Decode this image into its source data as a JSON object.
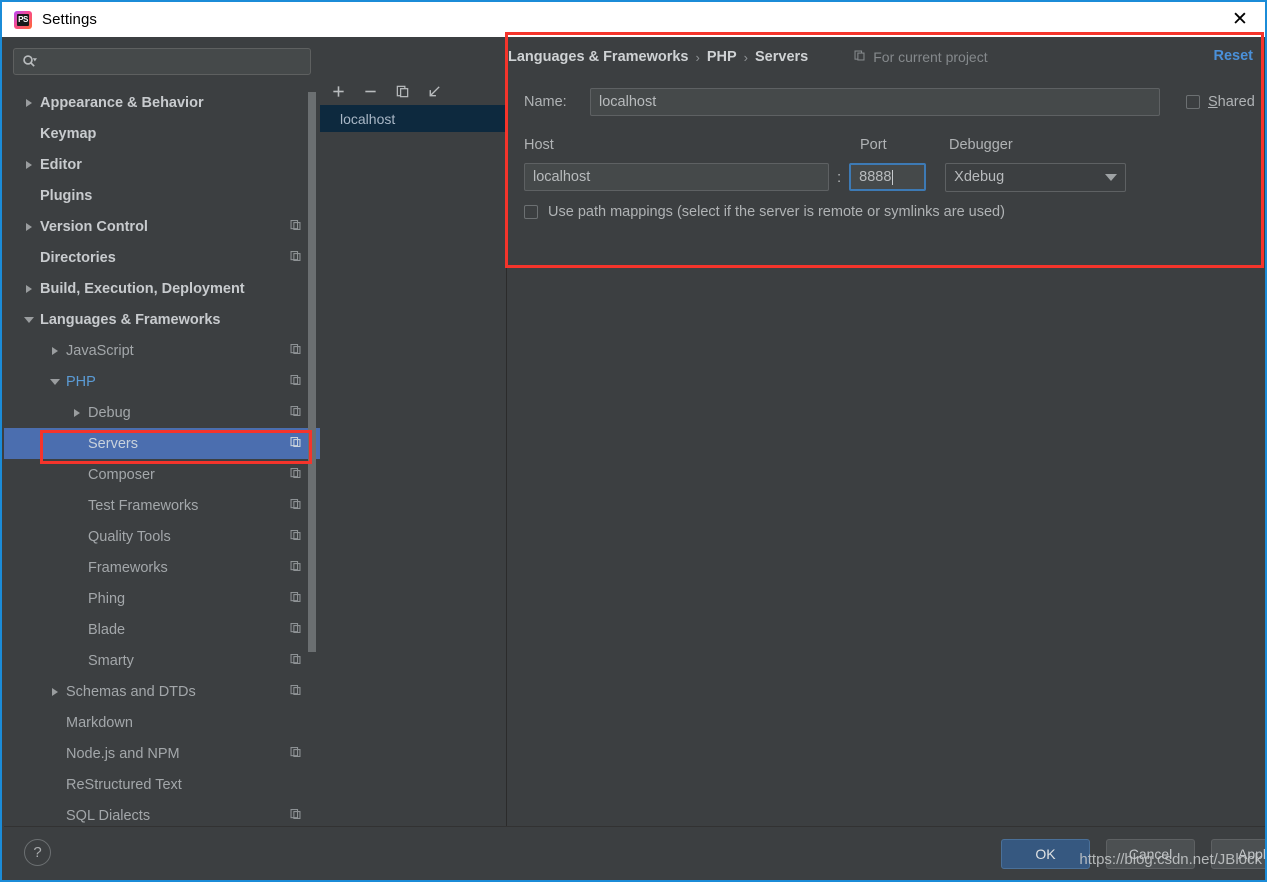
{
  "window": {
    "title": "Settings",
    "app_icon": "phpstorm-icon",
    "close_icon": "close-icon",
    "border_color": "#1b8cd8"
  },
  "search": {
    "value": "",
    "placeholder": "",
    "icon": "search-icon"
  },
  "sidebar": {
    "items": [
      {
        "label": "Appearance & Behavior",
        "level": 0,
        "arrow": "right",
        "copy": false,
        "style": "top"
      },
      {
        "label": "Keymap",
        "level": 0,
        "arrow": "none",
        "copy": false,
        "style": "top"
      },
      {
        "label": "Editor",
        "level": 0,
        "arrow": "right",
        "copy": false,
        "style": "top"
      },
      {
        "label": "Plugins",
        "level": 0,
        "arrow": "none",
        "copy": false,
        "style": "top"
      },
      {
        "label": "Version Control",
        "level": 0,
        "arrow": "right",
        "copy": true,
        "style": "top"
      },
      {
        "label": "Directories",
        "level": 0,
        "arrow": "none",
        "copy": true,
        "style": "top"
      },
      {
        "label": "Build, Execution, Deployment",
        "level": 0,
        "arrow": "right",
        "copy": false,
        "style": "top"
      },
      {
        "label": "Languages & Frameworks",
        "level": 0,
        "arrow": "down",
        "copy": false,
        "style": "top"
      },
      {
        "label": "JavaScript",
        "level": 1,
        "arrow": "right",
        "copy": true,
        "style": "child"
      },
      {
        "label": "PHP",
        "level": 1,
        "arrow": "down",
        "copy": true,
        "style": "modified"
      },
      {
        "label": "Debug",
        "level": 2,
        "arrow": "right",
        "copy": true,
        "style": "child"
      },
      {
        "label": "Servers",
        "level": 2,
        "arrow": "none",
        "copy": true,
        "style": "selected"
      },
      {
        "label": "Composer",
        "level": 2,
        "arrow": "none",
        "copy": true,
        "style": "child"
      },
      {
        "label": "Test Frameworks",
        "level": 2,
        "arrow": "none",
        "copy": true,
        "style": "child"
      },
      {
        "label": "Quality Tools",
        "level": 2,
        "arrow": "none",
        "copy": true,
        "style": "child"
      },
      {
        "label": "Frameworks",
        "level": 2,
        "arrow": "none",
        "copy": true,
        "style": "child"
      },
      {
        "label": "Phing",
        "level": 2,
        "arrow": "none",
        "copy": true,
        "style": "child"
      },
      {
        "label": "Blade",
        "level": 2,
        "arrow": "none",
        "copy": true,
        "style": "child"
      },
      {
        "label": "Smarty",
        "level": 2,
        "arrow": "none",
        "copy": true,
        "style": "child"
      },
      {
        "label": "Schemas and DTDs",
        "level": 1,
        "arrow": "right",
        "copy": true,
        "style": "child"
      },
      {
        "label": "Markdown",
        "level": 1,
        "arrow": "none",
        "copy": false,
        "style": "child"
      },
      {
        "label": "Node.js and NPM",
        "level": 1,
        "arrow": "none",
        "copy": true,
        "style": "child"
      },
      {
        "label": "ReStructured Text",
        "level": 1,
        "arrow": "none",
        "copy": false,
        "style": "child"
      },
      {
        "label": "SQL Dialects",
        "level": 1,
        "arrow": "none",
        "copy": true,
        "style": "child"
      }
    ],
    "selected": "Servers",
    "modified": "PHP"
  },
  "server_list": {
    "toolbar": [
      {
        "name": "add-server-button",
        "icon": "plus-icon"
      },
      {
        "name": "remove-server-button",
        "icon": "minus-icon"
      },
      {
        "name": "copy-server-button",
        "icon": "copy-icon"
      },
      {
        "name": "import-server-button",
        "icon": "import-arrow-icon"
      }
    ],
    "servers": [
      {
        "name": "localhost",
        "selected": true
      }
    ]
  },
  "breadcrumb": {
    "parts": [
      "Languages & Frameworks",
      "PHP",
      "Servers"
    ],
    "separator": "›",
    "scope_label": "For current project",
    "scope_icon": "copy-icon",
    "reset_label": "Reset",
    "reset_color": "#4a90d9"
  },
  "form": {
    "name_label": "Name:",
    "name_value": "localhost",
    "shared_label": "Shared",
    "shared_checked": false,
    "host_label": "Host",
    "host_value": "localhost",
    "port_label": "Port",
    "port_value": "8888",
    "port_focused": true,
    "colon": ":",
    "debugger_label": "Debugger",
    "debugger_value": "Xdebug",
    "debugger_options": [
      "Xdebug"
    ],
    "path_mappings_label": "Use path mappings (select if the server is remote or symlinks are used)",
    "path_mappings_checked": false
  },
  "footer": {
    "help_label": "?",
    "ok_label": "OK",
    "cancel_label": "Cancel",
    "apply_label": "Apply",
    "ok_color": "#365880"
  },
  "watermark": {
    "text": "https://blog.csdn.net/JBlock"
  },
  "annotations": {
    "highlight_color": "#f5342b",
    "boxes": [
      "server-settings-panel",
      "sidebar-item-servers"
    ]
  }
}
